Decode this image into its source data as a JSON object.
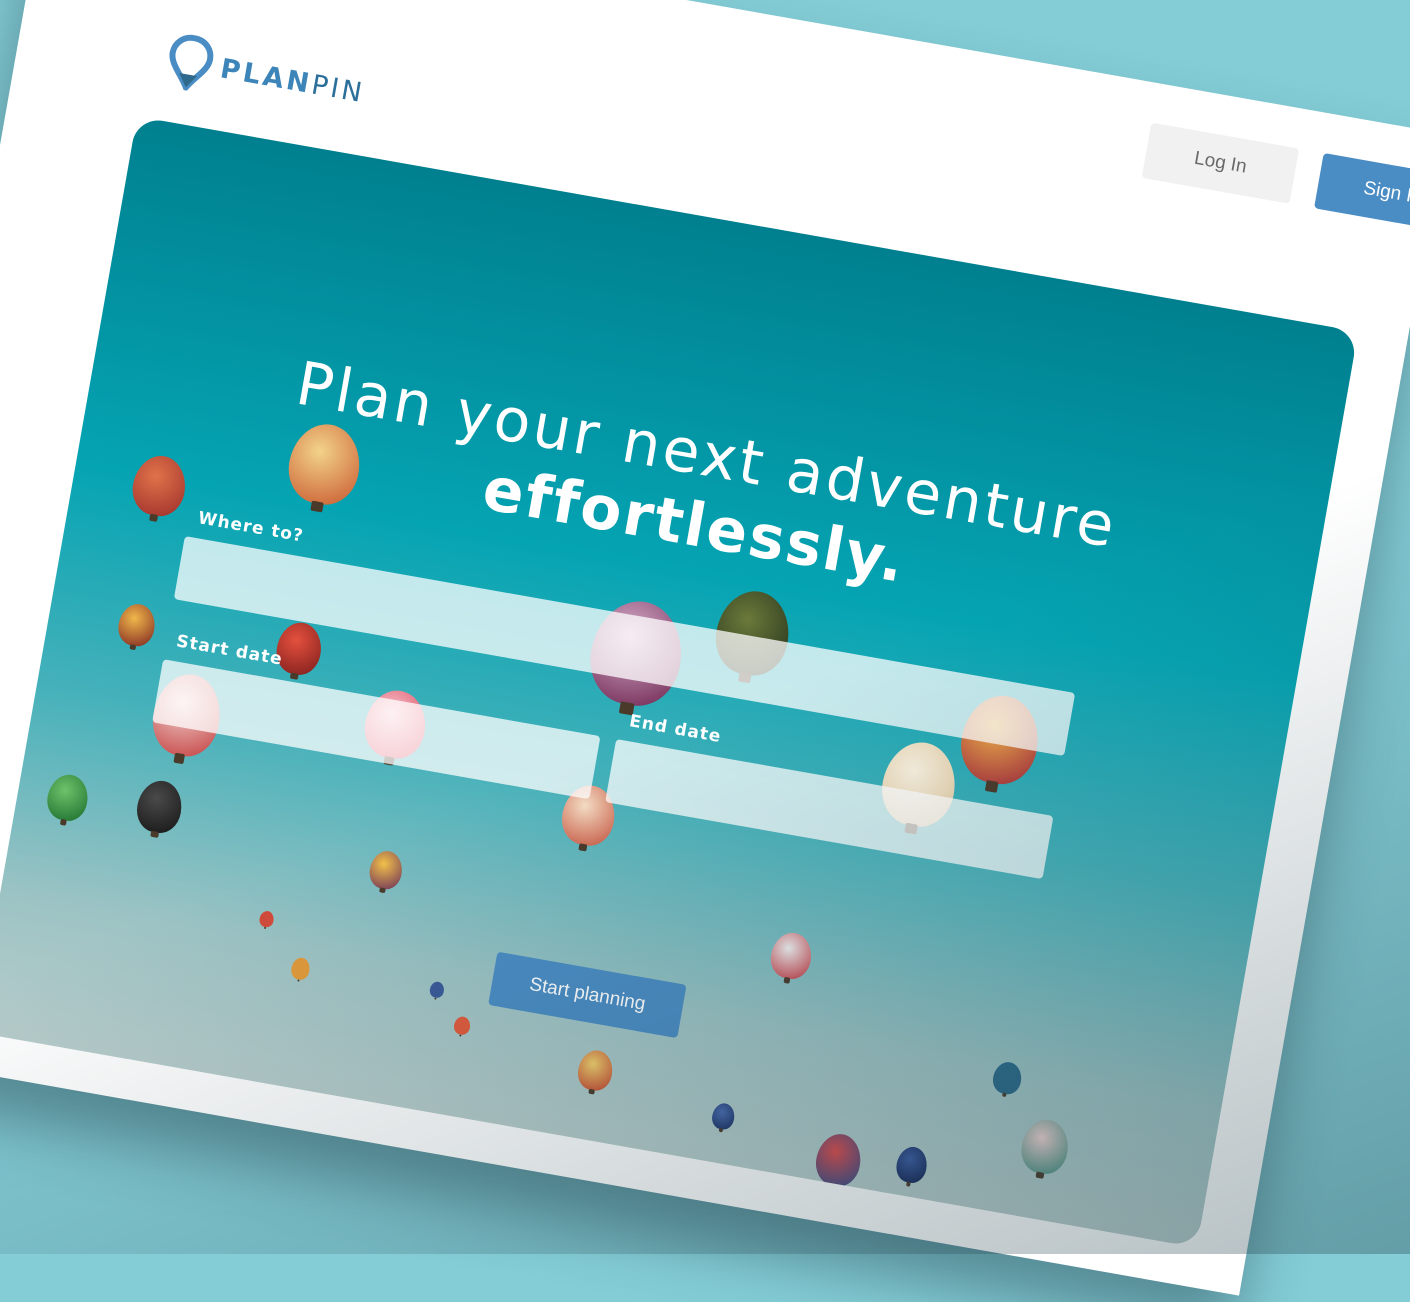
{
  "brand": {
    "name_bold": "PLAN",
    "name_light": "PIN",
    "logo_icon": "map-pin-icon"
  },
  "header": {
    "login_label": "Log In",
    "signin_label": "Sign In"
  },
  "hero": {
    "headline_line1": "Plan your next adventure",
    "headline_line2": "effortlessly."
  },
  "form": {
    "where_label": "Where to?",
    "where_value": "",
    "start_label": "Start date",
    "start_value": "",
    "end_label": "End date",
    "end_value": "",
    "submit_label": "Start planning"
  },
  "colors": {
    "accent": "#4a8cc4",
    "background": "#84cdd6",
    "sky_top": "#00808f",
    "sky_bottom": "#b7cccb"
  }
}
